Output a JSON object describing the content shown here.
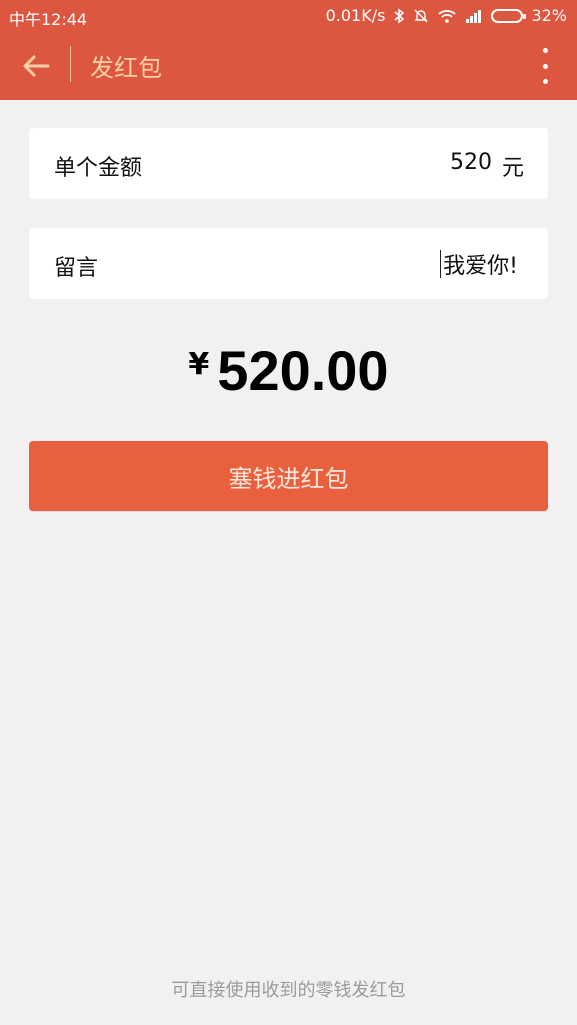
{
  "status_bar": {
    "time": "中午12:44",
    "network_speed": "0.01K/s",
    "battery_percent": "32%",
    "icons": [
      "bluetooth-icon",
      "mute-icon",
      "wifi-icon",
      "signal-icon",
      "battery-icon"
    ]
  },
  "header": {
    "title": "发红包",
    "back_icon": "arrow-left-icon",
    "menu_icon": "more-vertical-icon",
    "background_color": "#dd5740",
    "title_color": "#ffd0a6"
  },
  "amount_field": {
    "label": "单个金额",
    "value": "520",
    "unit": "元"
  },
  "message_field": {
    "label": "留言",
    "value": "我爱你!"
  },
  "total": {
    "currency": "¥",
    "amount": "520.00"
  },
  "submit_button": {
    "label": "塞钱进红包",
    "color": "#e9603e"
  },
  "footer": {
    "note": "可直接使用收到的零钱发红包"
  }
}
